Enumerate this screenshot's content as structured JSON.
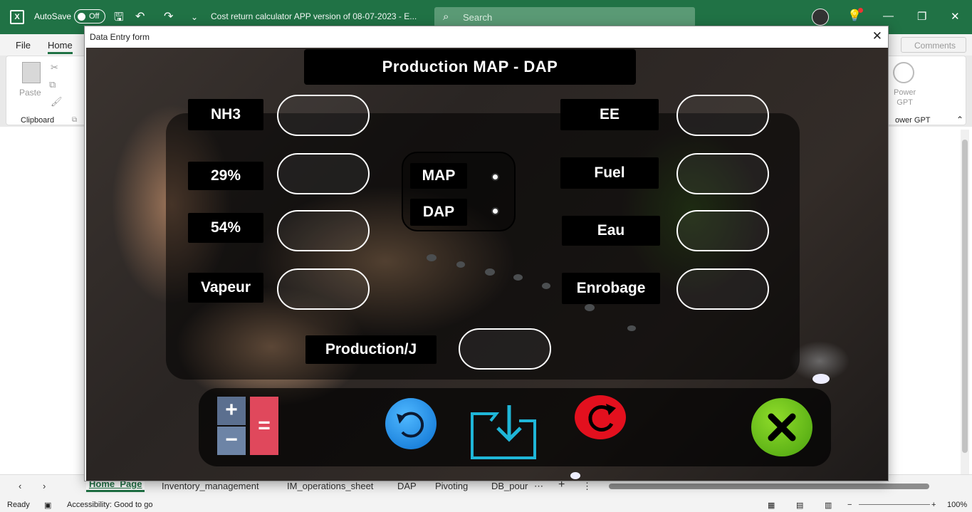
{
  "excel": {
    "autosave_label": "AutoSave",
    "autosave_state": "Off",
    "doc_title": "Cost return calculator APP version of 08-07-2023  -  E...",
    "search_placeholder": "Search",
    "tabs": [
      "File",
      "Home"
    ],
    "comments_label": "Comments",
    "paste_label": "Paste",
    "clipboard_label": "Clipboard",
    "power_gpt_label": "Power\nGPT",
    "power_gpt_group": "ower GPT",
    "sheet_tabs": [
      "Home_Page",
      "Inventory_management",
      "IM_operations_sheet",
      "DAP",
      "Pivoting",
      "DB_pour"
    ],
    "status_ready": "Ready",
    "accessibility": "Accessibility: Good to go",
    "zoom": "100%"
  },
  "dialog": {
    "title": "Data Entry form",
    "heading": "Production MAP - DAP",
    "left_fields": [
      "NH3",
      "29%",
      "54%",
      "Vapeur"
    ],
    "right_fields": [
      "EE",
      "Fuel",
      "Eau",
      "Enrobage"
    ],
    "radio_options": [
      "MAP",
      "DAP"
    ],
    "production_label": "Production/J",
    "buttons": {
      "calculator": "calculator-icon",
      "reset": "undo-icon",
      "save": "folder-download-icon",
      "refresh": "refresh-icon",
      "close": "close-icon"
    },
    "colors": {
      "excel_green": "#207245",
      "reset_blue": "#0a6fd0",
      "refresh_red": "#e3101e",
      "close_green": "#4aa20f",
      "calc_red": "#e0485c",
      "save_cyan": "#1fb6d8"
    }
  }
}
